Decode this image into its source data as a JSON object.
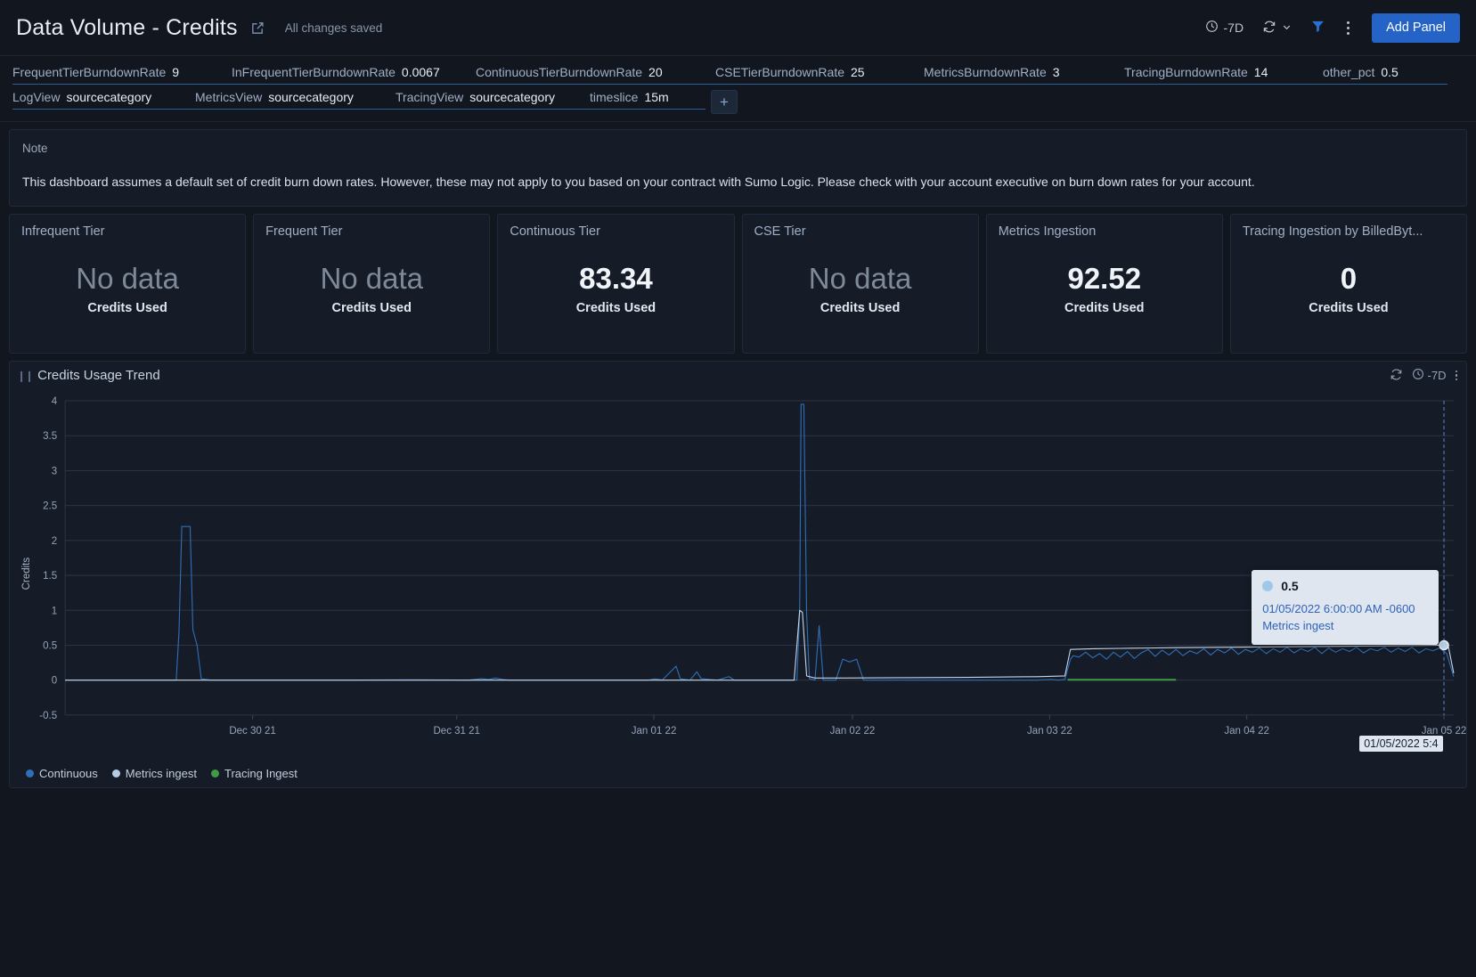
{
  "header": {
    "title": "Data Volume - Credits",
    "share_icon": "share-icon",
    "saved_status": "All changes saved",
    "time_range": "-7D",
    "refresh_icon": "refresh-icon",
    "chevron_icon": "chevron-down-icon",
    "filter_icon": "filter-icon",
    "more_icon": "kebab-menu-icon",
    "add_panel_label": "Add Panel",
    "accent_color": "#2563c7"
  },
  "variables": {
    "row1": [
      {
        "label": "FrequentTierBurndownRate",
        "value": "9"
      },
      {
        "label": "InFrequentTierBurndownRate",
        "value": "0.0067"
      },
      {
        "label": "ContinuousTierBurndownRate",
        "value": "20"
      },
      {
        "label": "CSETierBurndownRate",
        "value": "25"
      },
      {
        "label": "MetricsBurndownRate",
        "value": "3"
      },
      {
        "label": "TracingBurndownRate",
        "value": "14"
      },
      {
        "label": "other_pct",
        "value": "0.5"
      }
    ],
    "row2": [
      {
        "label": "LogView",
        "value": "sourcecategory"
      },
      {
        "label": "MetricsView",
        "value": "sourcecategory"
      },
      {
        "label": "TracingView",
        "value": "sourcecategory"
      },
      {
        "label": "timeslice",
        "value": "15m"
      }
    ],
    "add_label": "+"
  },
  "note": {
    "title": "Note",
    "body": "This dashboard assumes a default set of credit burn down rates. However, these may not apply to you based on your contract with Sumo Logic. Please check with your account executive on burn down rates for your account."
  },
  "kpis": [
    {
      "title": "Infrequent Tier",
      "value": "No data",
      "no_data": true,
      "sub": "Credits Used"
    },
    {
      "title": "Frequent Tier",
      "value": "No data",
      "no_data": true,
      "sub": "Credits Used"
    },
    {
      "title": "Continuous Tier",
      "value": "83.34",
      "no_data": false,
      "sub": "Credits Used"
    },
    {
      "title": "CSE Tier",
      "value": "No data",
      "no_data": true,
      "sub": "Credits Used"
    },
    {
      "title": "Metrics Ingestion",
      "value": "92.52",
      "no_data": false,
      "sub": "Credits Used"
    },
    {
      "title": "Tracing Ingestion by BilledByt...",
      "value": "0",
      "no_data": false,
      "sub": "Credits Used"
    }
  ],
  "chart_panel": {
    "title": "Credits Usage Trend",
    "grip_icon": "drag-handle-icon",
    "refresh_icon": "refresh-icon",
    "clock_icon": "clock-icon",
    "time_range": "-7D",
    "more_icon": "kebab-menu-icon"
  },
  "tooltip": {
    "value": "0.5",
    "timestamp": "01/05/2022 6:00:00 AM -0600",
    "series": "Metrics ingest",
    "dot_color": "#9fc8e8"
  },
  "cursor_label": "01/05/2022 5:4",
  "chart_data": {
    "type": "line",
    "title": "Credits Usage Trend",
    "xlabel": "",
    "ylabel": "Credits",
    "ylim": [
      -0.5,
      4
    ],
    "yticks": [
      "4",
      "3.5",
      "3",
      "2.5",
      "2",
      "1.5",
      "1",
      "0.5",
      "0",
      "-0.5"
    ],
    "ytick_values": [
      4,
      3.5,
      3,
      2.5,
      2,
      1.5,
      1,
      0.5,
      0,
      -0.5
    ],
    "xticks": [
      "Dec 30 21",
      "Dec 31 21",
      "Jan 01 22",
      "Jan 02 22",
      "Jan 03 22",
      "Jan 04 22",
      "Jan 05 22"
    ],
    "xtick_positions": [
      0.135,
      0.282,
      0.424,
      0.567,
      0.709,
      0.851,
      0.993
    ],
    "grid": true,
    "legend_position": "bottom-left",
    "series": [
      {
        "name": "Continuous",
        "color": "#2f6fb8",
        "points": [
          [
            0.0,
            0.0
          ],
          [
            0.055,
            0.0
          ],
          [
            0.08,
            0.0
          ],
          [
            0.082,
            0.7
          ],
          [
            0.084,
            2.2
          ],
          [
            0.09,
            2.2
          ],
          [
            0.092,
            0.72
          ],
          [
            0.095,
            0.5
          ],
          [
            0.098,
            0.02
          ],
          [
            0.105,
            0.0
          ],
          [
            0.15,
            0.0
          ],
          [
            0.2,
            0.0
          ],
          [
            0.25,
            0.005
          ],
          [
            0.29,
            0.0
          ],
          [
            0.3,
            0.02
          ],
          [
            0.305,
            0.01
          ],
          [
            0.31,
            0.03
          ],
          [
            0.315,
            0.01
          ],
          [
            0.32,
            0.0
          ],
          [
            0.38,
            0.0
          ],
          [
            0.42,
            0.0
          ],
          [
            0.425,
            0.02
          ],
          [
            0.43,
            0.0
          ],
          [
            0.44,
            0.2
          ],
          [
            0.443,
            0.02
          ],
          [
            0.45,
            0.0
          ],
          [
            0.455,
            0.12
          ],
          [
            0.458,
            0.02
          ],
          [
            0.47,
            0.0
          ],
          [
            0.478,
            0.05
          ],
          [
            0.482,
            0.0
          ],
          [
            0.5,
            0.0
          ],
          [
            0.51,
            0.0
          ],
          [
            0.52,
            0.0
          ],
          [
            0.527,
            0.0
          ],
          [
            0.529,
            1.0
          ],
          [
            0.53,
            3.95
          ],
          [
            0.532,
            3.95
          ],
          [
            0.534,
            0.95
          ],
          [
            0.536,
            0.02
          ],
          [
            0.54,
            0.0
          ],
          [
            0.543,
            0.78
          ],
          [
            0.546,
            0.0
          ],
          [
            0.55,
            0.0
          ],
          [
            0.555,
            0.0
          ],
          [
            0.56,
            0.3
          ],
          [
            0.565,
            0.26
          ],
          [
            0.57,
            0.3
          ],
          [
            0.575,
            0.0
          ],
          [
            0.6,
            0.0
          ],
          [
            0.65,
            0.0
          ],
          [
            0.7,
            0.0
          ],
          [
            0.71,
            0.01
          ],
          [
            0.715,
            0.0
          ],
          [
            0.72,
            0.01
          ],
          [
            0.724,
            0.3
          ],
          [
            0.726,
            0.35
          ],
          [
            0.73,
            0.33
          ],
          [
            0.735,
            0.4
          ],
          [
            0.74,
            0.32
          ],
          [
            0.745,
            0.38
          ],
          [
            0.75,
            0.3
          ],
          [
            0.755,
            0.4
          ],
          [
            0.76,
            0.33
          ],
          [
            0.765,
            0.41
          ],
          [
            0.77,
            0.31
          ],
          [
            0.775,
            0.39
          ],
          [
            0.78,
            0.44
          ],
          [
            0.785,
            0.34
          ],
          [
            0.79,
            0.43
          ],
          [
            0.795,
            0.36
          ],
          [
            0.8,
            0.44
          ],
          [
            0.805,
            0.35
          ],
          [
            0.81,
            0.42
          ],
          [
            0.815,
            0.38
          ],
          [
            0.82,
            0.45
          ],
          [
            0.825,
            0.36
          ],
          [
            0.83,
            0.44
          ],
          [
            0.835,
            0.39
          ],
          [
            0.84,
            0.46
          ],
          [
            0.845,
            0.37
          ],
          [
            0.85,
            0.44
          ],
          [
            0.855,
            0.4
          ],
          [
            0.86,
            0.46
          ],
          [
            0.865,
            0.38
          ],
          [
            0.87,
            0.45
          ],
          [
            0.875,
            0.4
          ],
          [
            0.88,
            0.47
          ],
          [
            0.885,
            0.39
          ],
          [
            0.89,
            0.45
          ],
          [
            0.895,
            0.41
          ],
          [
            0.9,
            0.47
          ],
          [
            0.905,
            0.38
          ],
          [
            0.91,
            0.46
          ],
          [
            0.915,
            0.4
          ],
          [
            0.92,
            0.45
          ],
          [
            0.925,
            0.41
          ],
          [
            0.93,
            0.47
          ],
          [
            0.935,
            0.39
          ],
          [
            0.94,
            0.45
          ],
          [
            0.945,
            0.42
          ],
          [
            0.95,
            0.47
          ],
          [
            0.955,
            0.4
          ],
          [
            0.96,
            0.46
          ],
          [
            0.965,
            0.41
          ],
          [
            0.97,
            0.47
          ],
          [
            0.975,
            0.39
          ],
          [
            0.98,
            0.45
          ],
          [
            0.985,
            0.42
          ],
          [
            0.99,
            0.46
          ],
          [
            0.995,
            0.38
          ],
          [
            1.0,
            0.05
          ]
        ]
      },
      {
        "name": "Metrics ingest",
        "color": "#c8d6e5",
        "points": [
          [
            0.0,
            0.0
          ],
          [
            0.2,
            0.0
          ],
          [
            0.4,
            0.0
          ],
          [
            0.5,
            0.0
          ],
          [
            0.525,
            0.0
          ],
          [
            0.529,
            1.0
          ],
          [
            0.531,
            0.97
          ],
          [
            0.534,
            0.06
          ],
          [
            0.54,
            0.03
          ],
          [
            0.56,
            0.03
          ],
          [
            0.6,
            0.035
          ],
          [
            0.65,
            0.04
          ],
          [
            0.7,
            0.05
          ],
          [
            0.72,
            0.06
          ],
          [
            0.724,
            0.44
          ],
          [
            0.74,
            0.45
          ],
          [
            0.76,
            0.455
          ],
          [
            0.78,
            0.46
          ],
          [
            0.8,
            0.465
          ],
          [
            0.83,
            0.47
          ],
          [
            0.86,
            0.475
          ],
          [
            0.89,
            0.48
          ],
          [
            0.92,
            0.485
          ],
          [
            0.95,
            0.49
          ],
          [
            0.975,
            0.495
          ],
          [
            0.99,
            0.5
          ],
          [
            0.996,
            0.5
          ],
          [
            1.0,
            0.1
          ]
        ]
      },
      {
        "name": "Tracing Ingest",
        "color": "#3f9c45",
        "points": [
          [
            0.722,
            0.005
          ],
          [
            0.76,
            0.005
          ],
          [
            0.79,
            0.005
          ],
          [
            0.8,
            0.005
          ]
        ]
      }
    ],
    "cursor_x": 0.993,
    "highlight_point": {
      "x": 0.993,
      "y": 0.5,
      "series": "Metrics ingest"
    }
  }
}
